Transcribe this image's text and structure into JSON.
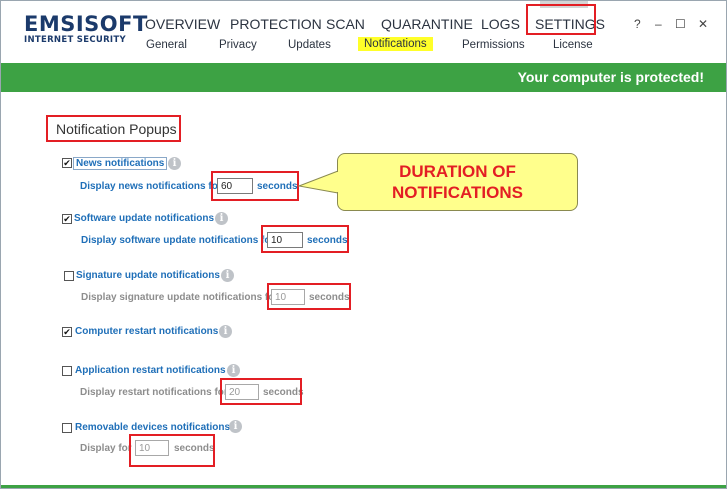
{
  "app": {
    "logo_main": "EMSISOFT",
    "logo_sub": "INTERNET SECURITY"
  },
  "nav": {
    "main": [
      "OVERVIEW",
      "PROTECTION",
      "SCAN",
      "QUARANTINE",
      "LOGS",
      "SETTINGS"
    ],
    "sub": [
      "General",
      "Privacy",
      "Updates",
      "Notifications",
      "Permissions",
      "License"
    ],
    "active_main": "SETTINGS",
    "active_sub": "Notifications"
  },
  "window_controls": {
    "help": "?",
    "minimize": "–",
    "maximize": "☐",
    "close": "✕"
  },
  "status": {
    "text": "Your computer is protected!",
    "color": "#3da244"
  },
  "section": {
    "title": "Notification Popups"
  },
  "options": [
    {
      "label": "News notifications",
      "checked": true,
      "sub_label": "Display news notifications for",
      "value": "60",
      "unit": "seconds",
      "enabled": true
    },
    {
      "label": "Software update notifications",
      "checked": true,
      "sub_label": "Display software update notifications for",
      "value": "10",
      "unit": "seconds",
      "enabled": true
    },
    {
      "label": "Signature update notifications",
      "checked": false,
      "sub_label": "Display signature update notifications for",
      "value": "10",
      "unit": "seconds",
      "enabled": false
    },
    {
      "label": "Computer restart notifications",
      "checked": true
    },
    {
      "label": "Application restart notifications",
      "checked": false,
      "sub_label": "Display restart notifications for",
      "value": "20",
      "unit": "seconds",
      "enabled": false
    },
    {
      "label": "Removable devices notifications",
      "checked": false,
      "sub_label": "Display for",
      "value": "10",
      "unit": "seconds",
      "enabled": false
    }
  ],
  "callout": {
    "line1": "DURATION OF",
    "line2": "NOTIFICATIONS",
    "color": "#e31e24"
  },
  "icons": {
    "info": "info-icon",
    "check": "✔"
  }
}
